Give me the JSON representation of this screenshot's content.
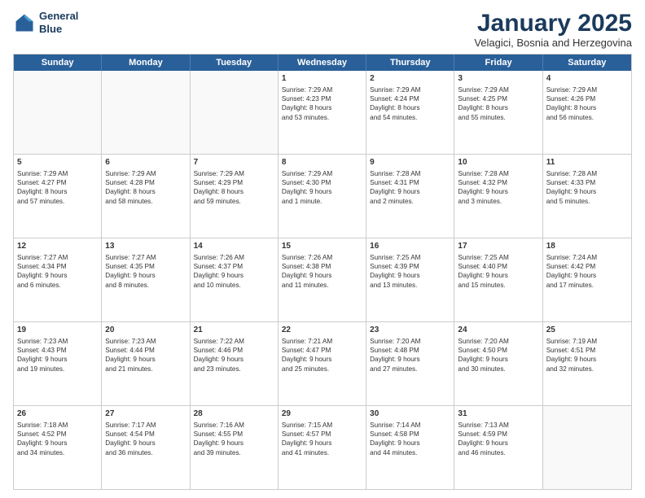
{
  "header": {
    "logo_line1": "General",
    "logo_line2": "Blue",
    "month": "January 2025",
    "location": "Velagici, Bosnia and Herzegovina"
  },
  "day_headers": [
    "Sunday",
    "Monday",
    "Tuesday",
    "Wednesday",
    "Thursday",
    "Friday",
    "Saturday"
  ],
  "weeks": [
    [
      {
        "num": "",
        "info": ""
      },
      {
        "num": "",
        "info": ""
      },
      {
        "num": "",
        "info": ""
      },
      {
        "num": "1",
        "info": "Sunrise: 7:29 AM\nSunset: 4:23 PM\nDaylight: 8 hours\nand 53 minutes."
      },
      {
        "num": "2",
        "info": "Sunrise: 7:29 AM\nSunset: 4:24 PM\nDaylight: 8 hours\nand 54 minutes."
      },
      {
        "num": "3",
        "info": "Sunrise: 7:29 AM\nSunset: 4:25 PM\nDaylight: 8 hours\nand 55 minutes."
      },
      {
        "num": "4",
        "info": "Sunrise: 7:29 AM\nSunset: 4:26 PM\nDaylight: 8 hours\nand 56 minutes."
      }
    ],
    [
      {
        "num": "5",
        "info": "Sunrise: 7:29 AM\nSunset: 4:27 PM\nDaylight: 8 hours\nand 57 minutes."
      },
      {
        "num": "6",
        "info": "Sunrise: 7:29 AM\nSunset: 4:28 PM\nDaylight: 8 hours\nand 58 minutes."
      },
      {
        "num": "7",
        "info": "Sunrise: 7:29 AM\nSunset: 4:29 PM\nDaylight: 8 hours\nand 59 minutes."
      },
      {
        "num": "8",
        "info": "Sunrise: 7:29 AM\nSunset: 4:30 PM\nDaylight: 9 hours\nand 1 minute."
      },
      {
        "num": "9",
        "info": "Sunrise: 7:28 AM\nSunset: 4:31 PM\nDaylight: 9 hours\nand 2 minutes."
      },
      {
        "num": "10",
        "info": "Sunrise: 7:28 AM\nSunset: 4:32 PM\nDaylight: 9 hours\nand 3 minutes."
      },
      {
        "num": "11",
        "info": "Sunrise: 7:28 AM\nSunset: 4:33 PM\nDaylight: 9 hours\nand 5 minutes."
      }
    ],
    [
      {
        "num": "12",
        "info": "Sunrise: 7:27 AM\nSunset: 4:34 PM\nDaylight: 9 hours\nand 6 minutes."
      },
      {
        "num": "13",
        "info": "Sunrise: 7:27 AM\nSunset: 4:35 PM\nDaylight: 9 hours\nand 8 minutes."
      },
      {
        "num": "14",
        "info": "Sunrise: 7:26 AM\nSunset: 4:37 PM\nDaylight: 9 hours\nand 10 minutes."
      },
      {
        "num": "15",
        "info": "Sunrise: 7:26 AM\nSunset: 4:38 PM\nDaylight: 9 hours\nand 11 minutes."
      },
      {
        "num": "16",
        "info": "Sunrise: 7:25 AM\nSunset: 4:39 PM\nDaylight: 9 hours\nand 13 minutes."
      },
      {
        "num": "17",
        "info": "Sunrise: 7:25 AM\nSunset: 4:40 PM\nDaylight: 9 hours\nand 15 minutes."
      },
      {
        "num": "18",
        "info": "Sunrise: 7:24 AM\nSunset: 4:42 PM\nDaylight: 9 hours\nand 17 minutes."
      }
    ],
    [
      {
        "num": "19",
        "info": "Sunrise: 7:23 AM\nSunset: 4:43 PM\nDaylight: 9 hours\nand 19 minutes."
      },
      {
        "num": "20",
        "info": "Sunrise: 7:23 AM\nSunset: 4:44 PM\nDaylight: 9 hours\nand 21 minutes."
      },
      {
        "num": "21",
        "info": "Sunrise: 7:22 AM\nSunset: 4:46 PM\nDaylight: 9 hours\nand 23 minutes."
      },
      {
        "num": "22",
        "info": "Sunrise: 7:21 AM\nSunset: 4:47 PM\nDaylight: 9 hours\nand 25 minutes."
      },
      {
        "num": "23",
        "info": "Sunrise: 7:20 AM\nSunset: 4:48 PM\nDaylight: 9 hours\nand 27 minutes."
      },
      {
        "num": "24",
        "info": "Sunrise: 7:20 AM\nSunset: 4:50 PM\nDaylight: 9 hours\nand 30 minutes."
      },
      {
        "num": "25",
        "info": "Sunrise: 7:19 AM\nSunset: 4:51 PM\nDaylight: 9 hours\nand 32 minutes."
      }
    ],
    [
      {
        "num": "26",
        "info": "Sunrise: 7:18 AM\nSunset: 4:52 PM\nDaylight: 9 hours\nand 34 minutes."
      },
      {
        "num": "27",
        "info": "Sunrise: 7:17 AM\nSunset: 4:54 PM\nDaylight: 9 hours\nand 36 minutes."
      },
      {
        "num": "28",
        "info": "Sunrise: 7:16 AM\nSunset: 4:55 PM\nDaylight: 9 hours\nand 39 minutes."
      },
      {
        "num": "29",
        "info": "Sunrise: 7:15 AM\nSunset: 4:57 PM\nDaylight: 9 hours\nand 41 minutes."
      },
      {
        "num": "30",
        "info": "Sunrise: 7:14 AM\nSunset: 4:58 PM\nDaylight: 9 hours\nand 44 minutes."
      },
      {
        "num": "31",
        "info": "Sunrise: 7:13 AM\nSunset: 4:59 PM\nDaylight: 9 hours\nand 46 minutes."
      },
      {
        "num": "",
        "info": ""
      }
    ]
  ]
}
